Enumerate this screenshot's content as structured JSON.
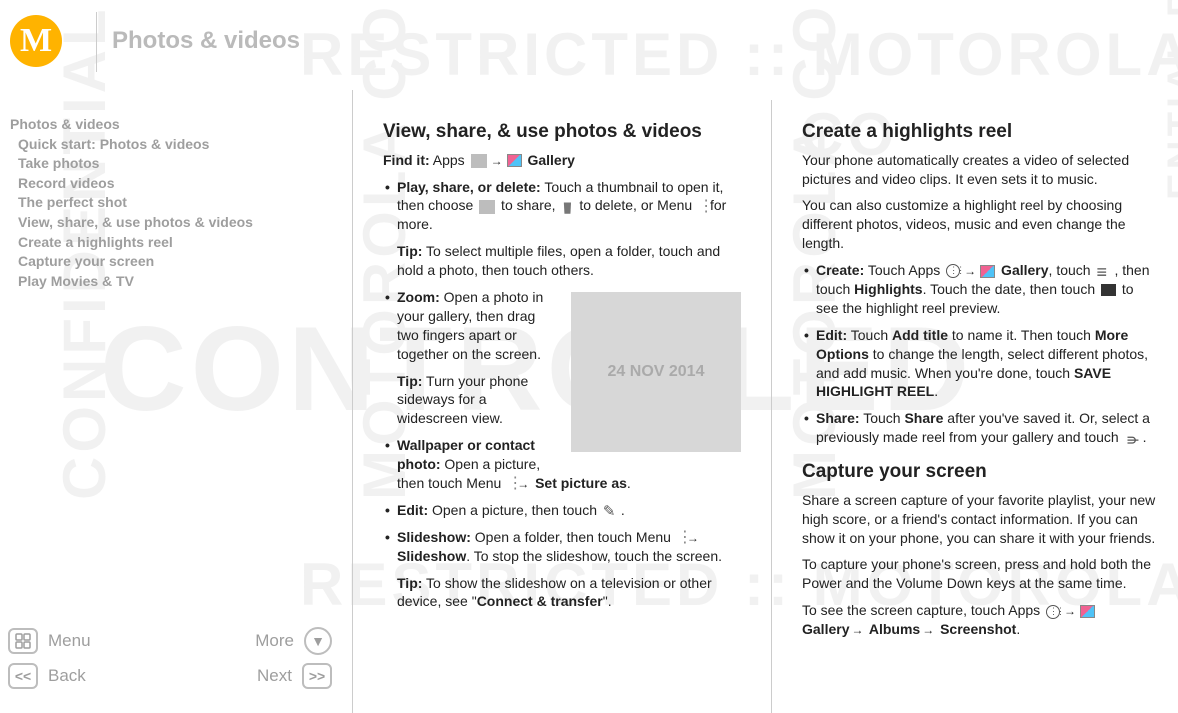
{
  "header": {
    "title": "Photos & videos",
    "logo_letter": "M"
  },
  "toc": [
    "Photos & videos",
    "Quick start: Photos & videos",
    "Take photos",
    "Record videos",
    "The perfect shot",
    "View, share, & use photos & videos",
    "Create a highlights reel",
    "Capture your screen",
    "Play Movies & TV"
  ],
  "nav": {
    "menu": "Menu",
    "more": "More",
    "back": "Back",
    "next": "Next"
  },
  "watermark_date": "24 NOV 2014",
  "col1": {
    "h1": "View, share, & use photos & videos",
    "find_label": "Find it:",
    "find_prefix": " Apps ",
    "find_suffix": " Gallery",
    "b1_label": "Play, share, or delete:",
    "b1_text": " Touch a thumbnail to open it, then choose ",
    "b1_mid1": " to share, ",
    "b1_mid2": " to delete, or Menu ",
    "b1_end": " for more.",
    "b1_tip_label": "Tip:",
    "b1_tip": " To select multiple files, open a folder, touch and hold a photo, then touch others.",
    "b2_label": "Zoom:",
    "b2_text": " Open a photo in your gallery, then drag two fingers apart or together on the screen.",
    "b2_tip_label": "Tip:",
    "b2_tip": " Turn your phone sideways for a widescreen view.",
    "b3_label": "Wallpaper or contact photo:",
    "b3_text": " Open a picture, then touch Menu ",
    "b3_end": " Set picture as",
    "b4_label": "Edit:",
    "b4_text": " Open a picture, then touch ",
    "b5_label": "Slideshow:",
    "b5_text": " Open a folder, then touch Menu ",
    "b5_end": " Slideshow",
    "b5_after": ". To stop the slideshow, touch the screen.",
    "b5_tip_label": "Tip:",
    "b5_tip_a": " To show the slideshow on a television or other device, see \"",
    "b5_tip_link": "Connect & transfer",
    "b5_tip_b": "\"."
  },
  "col2": {
    "h1": "Create a highlights reel",
    "p1": "Your phone automatically creates a video of selected pictures and video clips. It even sets it to music.",
    "p2": "You can also customize a highlight reel by choosing different photos, videos, music and even change the length.",
    "c1_label": "Create:",
    "c1_a": " Touch Apps ",
    "c1_b": " Gallery",
    "c1_c": ", touch ",
    "c1_d": ", then touch ",
    "c1_hl": "Highlights",
    "c1_e": ". Touch the date, then touch ",
    "c1_f": " to see the highlight reel preview.",
    "c2_label": "Edit:",
    "c2_a": " Touch ",
    "c2_add": "Add title",
    "c2_b": " to name it. Then touch ",
    "c2_more": "More Options",
    "c2_c": " to change the length, select different photos, and add music. When you're done, touch ",
    "c2_save": "SAVE HIGHLIGHT REEL",
    "c3_label": "Share:",
    "c3_a": " Touch ",
    "c3_share": "Share",
    "c3_b": " after you've saved it. Or, select a previously made reel from your gallery and touch ",
    "h2": "Capture your screen",
    "p3": "Share a screen capture of your favorite playlist, your new high score, or a friend's contact information. If you can show it on your phone, you can share it with your friends.",
    "p4": "To capture your phone's screen, press and hold both the Power and the Volume Down keys at the same time.",
    "p5a": "To see the screen capture, touch Apps ",
    "p5b": " Gallery",
    "p5c": " Albums",
    "p5d": " Screenshot"
  }
}
